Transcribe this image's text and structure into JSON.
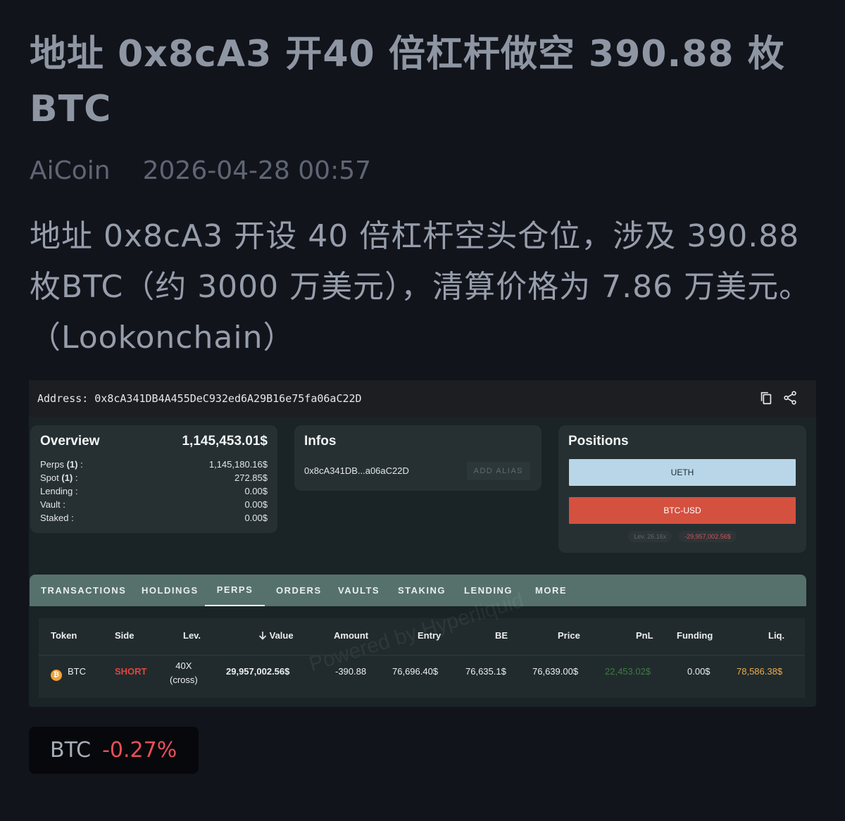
{
  "article": {
    "headline": "地址 0x8cA3 开40 倍杠杆做空 390.88 枚 BTC",
    "source": "AiCoin",
    "datetime": "2026-04-28 00:57",
    "body": "地址 0x8cA3 开设 40 倍杠杆空头仓位，涉及 390.88 枚BTC（约 3000 万美元），清算价格为 7.86 万美元。（Lookonchain）"
  },
  "screenshot": {
    "address_label": "Address: 0x8cA341DB4A455DeC932ed6A29B16e75fa06aC22D",
    "icons": {
      "copy": "copy-icon",
      "share": "share-icon"
    },
    "overview": {
      "title": "Overview",
      "total": "1,145,453.01$",
      "rows": [
        {
          "label": "Perps",
          "count": "(1)",
          "suffix": " :",
          "value": "1,145,180.16$"
        },
        {
          "label": "Spot",
          "count": "(1)",
          "suffix": " :",
          "value": "272.85$"
        },
        {
          "label": "Lending :",
          "count": "",
          "suffix": "",
          "value": "0.00$"
        },
        {
          "label": "Vault :",
          "count": "",
          "suffix": "",
          "value": "0.00$"
        },
        {
          "label": "Staked :",
          "count": "",
          "suffix": "",
          "value": "0.00$"
        }
      ]
    },
    "infos": {
      "title": "Infos",
      "short_address": "0x8cA341DB...a06aC22D",
      "add_alias": "ADD ALIAS"
    },
    "positions": {
      "title": "Positions",
      "items": [
        "UETH",
        "BTC-USD"
      ],
      "lev": "Lev. 26.16x",
      "pnl": "-29,957,002.56$"
    },
    "tabs": [
      "TRANSACTIONS",
      "HOLDINGS",
      "PERPS",
      "ORDERS",
      "VAULTS",
      "STAKING",
      "LENDING",
      "MORE"
    ],
    "active_tab": "PERPS",
    "table": {
      "headers": [
        "Token",
        "Side",
        "Lev.",
        "Value",
        "Amount",
        "Entry",
        "BE",
        "Price",
        "PnL",
        "Funding",
        "Liq."
      ],
      "sort_icon": "arrow-down-icon",
      "row": {
        "token": "BTC",
        "token_icon": "bitcoin-icon",
        "side": "SHORT",
        "lev_line1": "40X",
        "lev_line2": "(cross)",
        "value": "29,957,002.56$",
        "amount": "-390.88",
        "entry": "76,696.40$",
        "be": "76,635.1$",
        "price": "76,639.00$",
        "pnl": "22,453.02$",
        "funding": "0.00$",
        "liq": "78,586.38$"
      },
      "watermark": "Powered by Hyperliquid"
    },
    "colors": {
      "short": "#e0463f",
      "pnl": "#3f7a45",
      "liq": "#ecab52",
      "btc_usd": "#d5513f",
      "ueth": "#b8d6e8"
    }
  },
  "ticker": {
    "symbol": "BTC",
    "change": "-0.27%",
    "change_color": "#ea4e59"
  }
}
